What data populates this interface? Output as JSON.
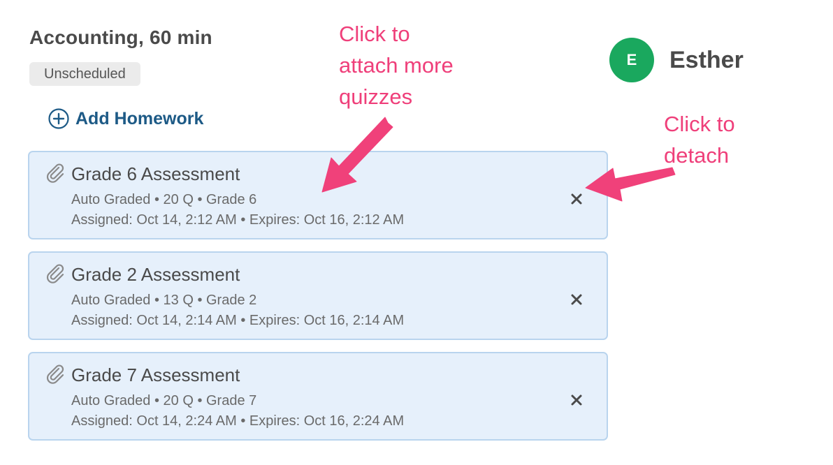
{
  "session": {
    "title": "Accounting, 60 min",
    "status": "Unscheduled"
  },
  "actions": {
    "add_homework_label": "Add Homework",
    "add_homework_icon": "plus-circle-icon",
    "detach_icon": "close-icon",
    "attachment_icon": "paperclip-icon"
  },
  "student": {
    "initial": "E",
    "name": "Esther",
    "avatar_color": "#1aa85e"
  },
  "quizzes": [
    {
      "title": "Grade 6 Assessment",
      "meta": "Auto Graded • 20 Q • Grade 6",
      "dates": "Assigned: Oct 14, 2:12 AM • Expires: Oct 16, 2:12 AM"
    },
    {
      "title": "Grade 2 Assessment",
      "meta": "Auto Graded • 13 Q • Grade 2",
      "dates": "Assigned: Oct 14, 2:14 AM • Expires: Oct 16, 2:14 AM"
    },
    {
      "title": "Grade 7 Assessment",
      "meta": "Auto Graded • 20 Q • Grade 7",
      "dates": "Assigned: Oct 14, 2:24 AM • Expires: Oct 16, 2:24 AM"
    }
  ],
  "annotations": {
    "attach": "Click to\nattach more\nquizzes",
    "detach": "Click to\ndetach",
    "color": "#ef3f7a"
  },
  "colors": {
    "card_background": "#e6f0fb",
    "card_border": "#b9d4ee",
    "link": "#1d5a86"
  }
}
